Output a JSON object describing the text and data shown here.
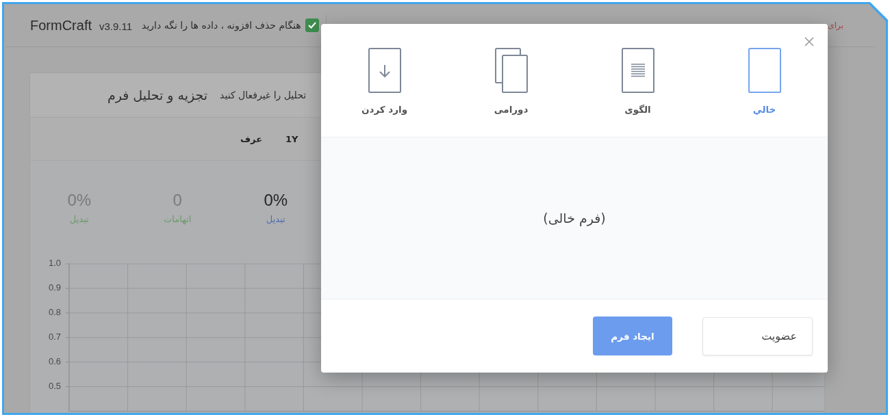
{
  "header": {
    "logo": "FormCraft",
    "version": "v3.9.11",
    "keep_data_checkbox": {
      "label": "هنگام حذف افزونه ، داده ها را نگه دارید",
      "checked": true
    },
    "notice": "برای"
  },
  "analytics_card": {
    "title": "تجزیه و تحلیل فرم",
    "disable_link": "تحلیل را غیرفعال کنید",
    "ranges": [
      "1Y",
      "عرف"
    ],
    "stats": [
      {
        "value": "0%",
        "label": "تبدیل",
        "selected": true
      },
      {
        "value": "0",
        "label": "اتهامات",
        "selected": false
      },
      {
        "value": "0%",
        "label": "تبدیل",
        "selected": false
      }
    ],
    "chart_data": {
      "type": "line",
      "grid": true,
      "categories": [
        null,
        null,
        null,
        null,
        null,
        null,
        null,
        null,
        null,
        null,
        null,
        null,
        null
      ],
      "ylim": [
        0.4,
        1.0
      ],
      "yticks": [
        {
          "value": 0.5,
          "label": "0.5"
        },
        {
          "value": 0.6,
          "label": "0.6"
        },
        {
          "value": 0.7,
          "label": "0.7"
        },
        {
          "value": 0.8,
          "label": "0.8"
        },
        {
          "value": 0.9,
          "label": "0.9"
        },
        {
          "value": 1.0,
          "label": "1.0"
        }
      ]
    }
  },
  "new_form_dialog": {
    "options": [
      {
        "kind": "blank",
        "label": "خالي",
        "selected": true
      },
      {
        "kind": "template",
        "label": "الگوی",
        "selected": false
      },
      {
        "kind": "duplicate",
        "label": "دورامی",
        "selected": false
      },
      {
        "kind": "import",
        "label": "وارد کردن",
        "selected": false
      }
    ],
    "preview": "(فرم خالی)",
    "form_name_field": {
      "value": "عضویت"
    },
    "create_button": "ایجاد فرم"
  }
}
